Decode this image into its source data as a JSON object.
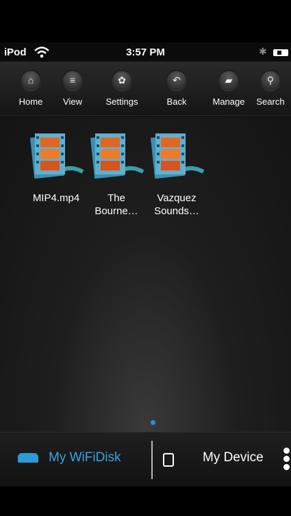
{
  "status_bar": {
    "carrier": "iPod",
    "time": "3:57 PM",
    "bluetooth_glyph": "✱"
  },
  "toolbar": {
    "buttons": [
      {
        "label": "Home",
        "icon": "home-icon",
        "glyph": "⌂"
      },
      {
        "label": "View",
        "icon": "list-view-icon",
        "glyph": "≡"
      },
      {
        "label": "Settings",
        "icon": "gear-icon",
        "glyph": "✿"
      },
      {
        "label": "Back",
        "icon": "back-arrow-icon",
        "glyph": "↶"
      },
      {
        "label": "Manage",
        "icon": "folder-icon",
        "glyph": "▰"
      },
      {
        "label": "Search",
        "icon": "search-icon",
        "glyph": "⚲"
      }
    ]
  },
  "files": [
    {
      "name_line1": "MIP4.mp4",
      "name_line2": "",
      "icon": "video-file-icon"
    },
    {
      "name_line1": "The",
      "name_line2": "Bourne…",
      "icon": "video-file-icon"
    },
    {
      "name_line1": "Vazquez",
      "name_line2": "Sounds…",
      "icon": "video-file-icon"
    }
  ],
  "tabbar": {
    "tabs": [
      {
        "label": "My WiFiDisk",
        "icon": "wifidisk-icon",
        "active": true
      },
      {
        "label": "My Device",
        "icon": "device-icon",
        "active": false
      }
    ]
  },
  "colors": {
    "accent": "#3aa5e2",
    "page_dot": "#2d8ed8"
  }
}
